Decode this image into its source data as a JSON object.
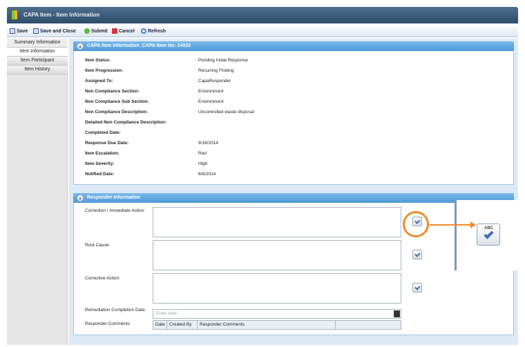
{
  "window": {
    "title": "CAPA Item - Item Information"
  },
  "toolbar": {
    "save": "Save",
    "save_close": "Save and Close",
    "submit": "Submit",
    "cancel": "Cancel",
    "refresh": "Refresh"
  },
  "sidebar": {
    "items": [
      {
        "label": "Summary Information"
      },
      {
        "label": "Item Information"
      },
      {
        "label": "Item Participant"
      },
      {
        "label": "Item History"
      }
    ]
  },
  "info_panel": {
    "title": "CAPA Item Information_CAPA Item No: 24932",
    "rows": [
      {
        "label": "Item Status:",
        "value": "Pending Initial Response"
      },
      {
        "label": "Item Progression:",
        "value": "Recurring Finding"
      },
      {
        "label": "Assigned To:",
        "value": "CapaResponder"
      },
      {
        "label": "Non Compliance Section:",
        "value": "Environment"
      },
      {
        "label": "Non Compliance Sub Section:",
        "value": "Environment"
      },
      {
        "label": "Non Compliance Description:",
        "value": "Uncontrolled waste disposal"
      },
      {
        "label": "Detailed Non Compliance Description:",
        "value": ""
      },
      {
        "label": "Completed Date:",
        "value": ""
      },
      {
        "label": "Response Due Date:",
        "value": "9/16/2014"
      },
      {
        "label": "Item Escalation:",
        "value": "Red"
      },
      {
        "label": "Item Severity:",
        "value": "High"
      },
      {
        "label": "Notified Date:",
        "value": "6/6/2014"
      }
    ]
  },
  "responder_panel": {
    "title": "Responder Information",
    "correction_label": "Correction / Immediate Action:",
    "root_cause_label": "Root Cause:",
    "corrective_label": "Corrective Action:",
    "remediation_label": "Remediation Completion Date:",
    "date_placeholder": "Enter date",
    "comments_label": "Responder Comments",
    "comments_columns": [
      "Date",
      "Created By",
      "Responder Comments"
    ]
  },
  "callout": {
    "abc_text": "ABC"
  },
  "colors": {
    "accent": "#f0892a",
    "panel_header": "#4f9ad8"
  }
}
